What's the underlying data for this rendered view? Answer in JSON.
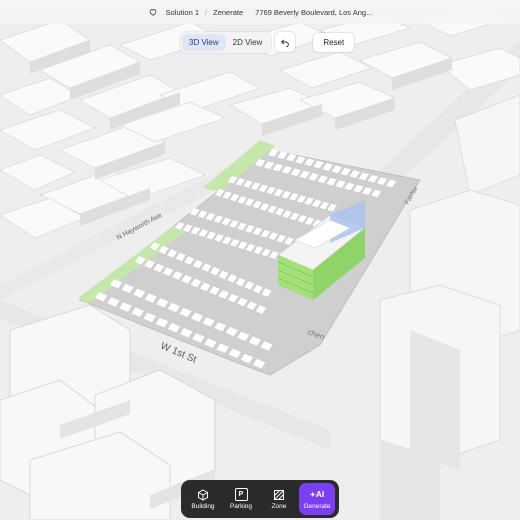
{
  "header": {
    "project": "Solution 1",
    "separator": "/",
    "section": "Zenerate",
    "address": "7769 Beverly Boulevard, Los Ang..."
  },
  "view_controls": {
    "view_3d": "3D View",
    "view_2d": "2D View",
    "active_view": "3D View",
    "undo_icon": "undo-icon",
    "reset": "Reset"
  },
  "map": {
    "street_labels": [
      "N Hayworth Ave",
      "W 1st St",
      "Fairfax"
    ],
    "building_label_fragment": "chen",
    "accent_green": "#9fe070",
    "glass_blue": "#aac4ec",
    "lot_color": "#cfcfcf"
  },
  "toolbar": {
    "items": [
      {
        "label": "Building",
        "icon": "cube-icon"
      },
      {
        "label": "Parking",
        "icon": "parking-icon"
      },
      {
        "label": "Zone",
        "icon": "hatch-square-icon"
      },
      {
        "label": "Generate",
        "icon": "ai-sparkle-icon",
        "badge": "AI"
      }
    ],
    "ai_color": "#7b3ff2"
  }
}
